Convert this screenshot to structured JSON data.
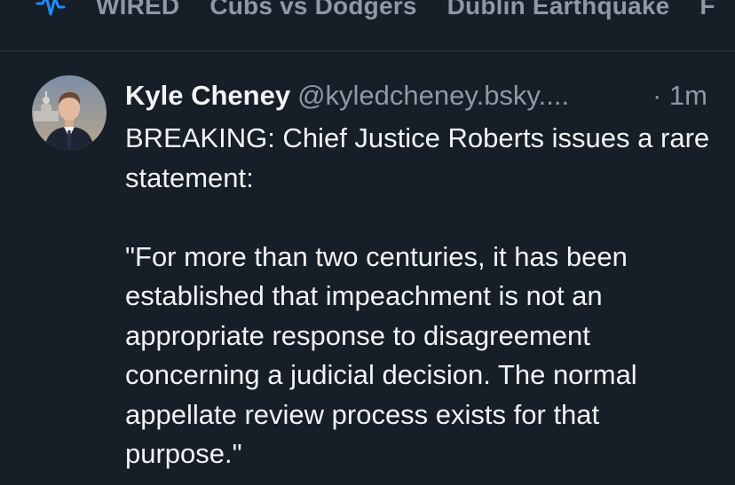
{
  "feed_tabs": {
    "icon": "activity-wave-icon",
    "items": [
      "WIRED",
      "Cubs vs Dodgers",
      "Dublin Earthquake",
      "F"
    ]
  },
  "post": {
    "avatar_icon": "profile-photo-avatar",
    "author_name": "Kyle Cheney",
    "handle": "@kyledcheney.bsky....",
    "timestamp": "· 1m",
    "paragraphs": [
      "BREAKING: Chief Justice Roberts issues a rare statement:",
      "\"For more than two centuries, it has been established that impeachment is not an appropriate response to disagreement concerning a judicial decision. The normal appellate review process exists for that purpose.\""
    ]
  },
  "colors": {
    "background": "#161e27",
    "primary_text": "#f1f3f5",
    "secondary_text": "#8d99a8",
    "accent": "#208bfe",
    "divider": "#2e3945"
  }
}
